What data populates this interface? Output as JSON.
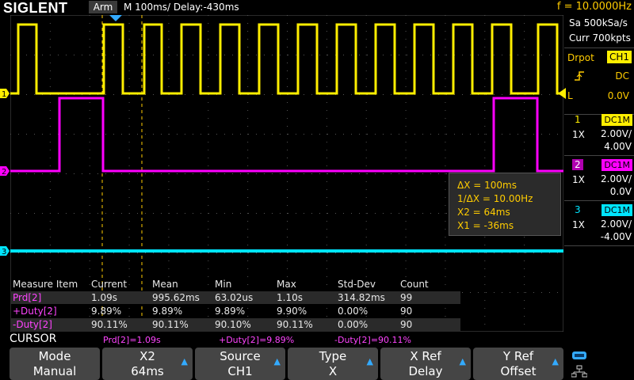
{
  "topbar": {
    "brand": "SIGLENT",
    "run_state": "Arm",
    "timebase": "M 100ms/  Delay:-430ms",
    "frequency": "f = 10.0000Hz"
  },
  "acquisition": {
    "sample_rate": "Sa 500kSa/s",
    "memory_depth": "Curr 700kpts"
  },
  "trigger": {
    "type": "Drpot",
    "source": "CH1",
    "coupling": "DC",
    "mode": "L",
    "level": "0.0V",
    "slope_icon": "rising-edge-icon"
  },
  "channels": [
    {
      "num": "1",
      "coupling": "DC1M",
      "probe": "1X",
      "scale": "2.00V/",
      "offset": "4.00V",
      "color": "#ffee00",
      "marker": "1"
    },
    {
      "num": "2",
      "coupling": "DC1M",
      "probe": "1X",
      "scale": "2.00V/",
      "offset": "0.0V",
      "color": "#ff00ff",
      "marker": "2"
    },
    {
      "num": "3",
      "coupling": "DC1M",
      "probe": "1X",
      "scale": "2.00V/",
      "offset": "-4.00V",
      "color": "#00e5ff",
      "marker": "3"
    }
  ],
  "cursor_info": {
    "dx": "ΔX = 100ms",
    "inv_dx": "1/ΔX = 10.00Hz",
    "x2": "X2 = 64ms",
    "x1": "X1 = -36ms"
  },
  "measure": {
    "headers": [
      "Measure Item",
      "Current",
      "Mean",
      "Min",
      "Max",
      "Std-Dev",
      "Count"
    ],
    "rows": [
      [
        "Prd[2]",
        "1.09s",
        "995.62ms",
        "63.02us",
        "1.10s",
        "314.82ms",
        "99"
      ],
      [
        "+Duty[2]",
        "9.89%",
        "9.89%",
        "9.89%",
        "9.90%",
        "0.00%",
        "90"
      ],
      [
        "-Duty[2]",
        "90.11%",
        "90.11%",
        "90.10%",
        "90.11%",
        "0.00%",
        "90"
      ]
    ]
  },
  "cursor_status": {
    "title": "CURSOR",
    "items": [
      "Prd[2]=1.09s",
      "+Duty[2]=9.89%",
      "-Duty[2]=90.11%"
    ]
  },
  "menu": {
    "mode": {
      "label": "Mode",
      "value": "Manual"
    },
    "x2": {
      "label": "X2",
      "value": "64ms"
    },
    "source": {
      "label": "Source",
      "value": "CH1"
    },
    "type": {
      "label": "Type",
      "value": "X"
    },
    "xref": {
      "label": "X Ref",
      "value": "Delay"
    },
    "yref": {
      "label": "Y Ref",
      "value": "Offset"
    },
    "arrow": "▲"
  },
  "status_icons": [
    "usb-icon",
    "network-icon"
  ],
  "colors": {
    "ch1": "#ffee00",
    "ch2": "#ff00ff",
    "ch3": "#00e5ff",
    "cursor": "#ffcc00",
    "accent": "#33aaff"
  }
}
